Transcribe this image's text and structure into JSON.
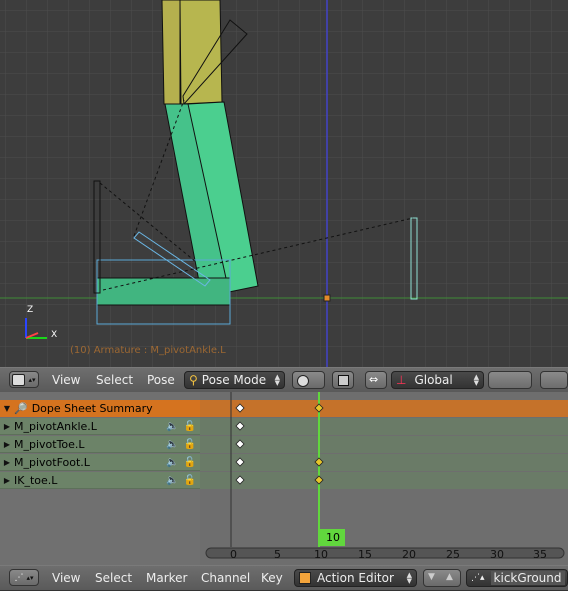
{
  "viewport": {
    "info_label": "(10) Armature : M_pivotAnkle.L",
    "axis_x": "X",
    "axis_z": "Z"
  },
  "viewport_header": {
    "editor_icon": "3d-view-icon",
    "menus": [
      "View",
      "Select",
      "Pose"
    ],
    "mode": "Pose Mode",
    "orientation": "Global"
  },
  "dopesheet": {
    "channels": [
      {
        "name": "Dope Sheet Summary",
        "type": "summary"
      },
      {
        "name": "M_pivotAnkle.L",
        "type": "group"
      },
      {
        "name": "M_pivotToe.L",
        "type": "group"
      },
      {
        "name": "M_pivotFoot.L",
        "type": "group"
      },
      {
        "name": "IK_toe.L",
        "type": "group"
      }
    ],
    "current_frame": "10",
    "ticks": [
      "0",
      "5",
      "10",
      "15",
      "20",
      "25",
      "30",
      "35"
    ]
  },
  "dopesheet_header": {
    "editor_icon": "dopesheet-icon",
    "menus": [
      "View",
      "Select",
      "Marker",
      "Channel",
      "Key"
    ],
    "mode": "Action Editor",
    "action": "kickGround"
  },
  "colors": {
    "summary": "#d5731f",
    "group": "#6c8368",
    "playhead": "#61d73d",
    "viewport_bg": "#3d3d3d"
  }
}
